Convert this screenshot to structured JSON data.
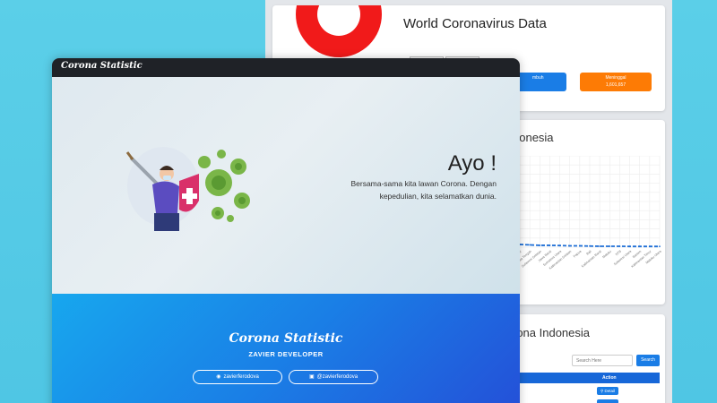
{
  "app": {
    "brand": "Corona Statistic"
  },
  "hero": {
    "title": "Ayo !",
    "line1": "Bersama-sama kita lawan Corona. Dengan",
    "line2": "kepedulian, kita selamatkan dunia."
  },
  "footer": {
    "brand": "Corona Statistic",
    "subtitle": "ZAVIER DEVELOPER",
    "github_label": "zavierferodova",
    "instagram_label": "@zavierferodova"
  },
  "world": {
    "title": "World Coronavirus Data",
    "recovered_label": "mbuh",
    "deaths_label": "Meninggal",
    "deaths_value": "1,601,657",
    "colors": {
      "positive": "#f11a1a",
      "recovered": "#f5b400",
      "deaths": "#fd7b05",
      "recovered_btn": "#1a7de6"
    }
  },
  "chart_card": {
    "title": "donesia"
  },
  "table_card": {
    "title": "rona Indonesia",
    "search_placeholder": "Search Here",
    "search_button": "Search",
    "action_header": "Action",
    "detail_label": "Detail"
  },
  "chart_data": {
    "type": "line",
    "title": "",
    "xlabel": "",
    "ylabel": "",
    "grid": true,
    "categories": [
      "Jawa Timur",
      "Jawa Tengah",
      "Sulawesi Selatan",
      "Jawa Barat",
      "Sumatera Utara",
      "Kalimantan Selatan",
      "Papua",
      "Bali",
      "Kalimantan Barat",
      "Maluku",
      "NTB",
      "Sulawesi Utara",
      "Banten",
      "Kalimantan Timur",
      "Maluku Utara"
    ],
    "series": [
      {
        "values": [
          3,
          2.5,
          2,
          2,
          1.8,
          1.5,
          1.5,
          1.2,
          1,
          1,
          1,
          0.8,
          0.8,
          0.8,
          0.8
        ]
      }
    ],
    "ylim": [
      0,
      100
    ]
  },
  "icons": {
    "github": "github-icon",
    "instagram": "instagram-icon"
  }
}
